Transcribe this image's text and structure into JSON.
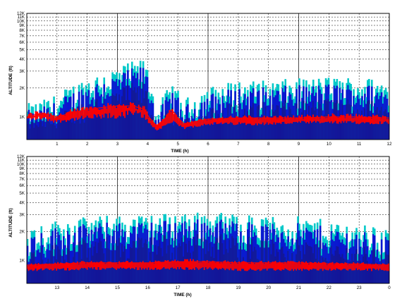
{
  "chart_data": [
    {
      "type": "area",
      "title": "",
      "xlabel": "TIME (h)",
      "ylabel": "ALTITUDE (ft)",
      "xlim": [
        0,
        12
      ],
      "x_ticks": [
        "1",
        "2",
        "3",
        "4",
        "5",
        "6",
        "7",
        "8",
        "9",
        "10",
        "11",
        "12"
      ],
      "y_scale": "log",
      "y_ticks": [
        "1K",
        "2K",
        "3K",
        "4K",
        "5K",
        "6K",
        "7K",
        "8K",
        "9K",
        "10K",
        "11K",
        "12K"
      ],
      "grid": true,
      "legend": "none",
      "colors": {
        "envelope": "#00c8c8",
        "band": "#0a14d0",
        "dense": "#15158a",
        "median": "#ff0000",
        "mid_ref": "#008a80"
      },
      "series": [
        {
          "values": [
            [
              0.0,
              0.9,
              1.0,
              1.2
            ],
            [
              0.5,
              0.95,
              1.1,
              1.3
            ],
            [
              1.0,
              0.8,
              1.0,
              1.5
            ],
            [
              1.5,
              0.9,
              1.1,
              1.9
            ],
            [
              2.0,
              0.95,
              1.2,
              2.3
            ],
            [
              2.5,
              1.0,
              1.25,
              2.6
            ],
            [
              3.0,
              1.0,
              1.3,
              2.9
            ],
            [
              3.5,
              1.1,
              1.3,
              3.3
            ],
            [
              3.9,
              1.0,
              1.2,
              3.5
            ],
            [
              4.3,
              0.4,
              0.6,
              1.0
            ],
            [
              4.8,
              0.8,
              1.2,
              2.0
            ],
            [
              5.2,
              0.5,
              0.7,
              1.3
            ],
            [
              5.6,
              0.6,
              0.8,
              1.6
            ],
            [
              6.0,
              0.7,
              0.9,
              1.8
            ],
            [
              7.0,
              0.7,
              0.95,
              2.1
            ],
            [
              8.0,
              0.7,
              0.95,
              2.1
            ],
            [
              9.0,
              0.75,
              0.95,
              2.2
            ],
            [
              10.0,
              0.75,
              1.0,
              2.3
            ],
            [
              11.0,
              0.75,
              1.0,
              2.3
            ],
            [
              12.0,
              0.75,
              0.95,
              2.1
            ]
          ]
        }
      ]
    },
    {
      "type": "area",
      "title": "",
      "xlabel": "TIME (h)",
      "ylabel": "ALTITUDE (ft)",
      "xlim": [
        12,
        24
      ],
      "x_ticks": [
        "13",
        "14",
        "15",
        "16",
        "17",
        "18",
        "19",
        "20",
        "21",
        "22",
        "23",
        "0"
      ],
      "y_scale": "log",
      "y_ticks": [
        "1K",
        "2K",
        "3K",
        "4K",
        "5K",
        "6K",
        "7K",
        "8K",
        "9K",
        "10K",
        "11K",
        "12K"
      ],
      "grid": true,
      "legend": "none",
      "colors": {
        "envelope": "#00c8c8",
        "band": "#0a14d0",
        "dense": "#15158a",
        "median": "#ff0000"
      },
      "series": [
        {
          "values": [
            [
              12.0,
              0.6,
              0.8,
              2.0
            ],
            [
              13.0,
              0.6,
              0.85,
              2.3
            ],
            [
              14.0,
              0.65,
              0.9,
              2.5
            ],
            [
              15.0,
              0.65,
              0.9,
              2.6
            ],
            [
              16.0,
              0.65,
              0.9,
              2.6
            ],
            [
              17.0,
              0.65,
              0.95,
              2.8
            ],
            [
              18.0,
              0.65,
              0.95,
              2.8
            ],
            [
              19.0,
              0.6,
              0.9,
              2.7
            ],
            [
              20.0,
              0.6,
              0.9,
              2.5
            ],
            [
              21.0,
              0.6,
              0.9,
              2.5
            ],
            [
              22.0,
              0.6,
              0.85,
              2.3
            ],
            [
              23.0,
              0.6,
              0.85,
              2.1
            ],
            [
              24.0,
              0.6,
              0.8,
              1.9
            ]
          ]
        }
      ]
    }
  ]
}
